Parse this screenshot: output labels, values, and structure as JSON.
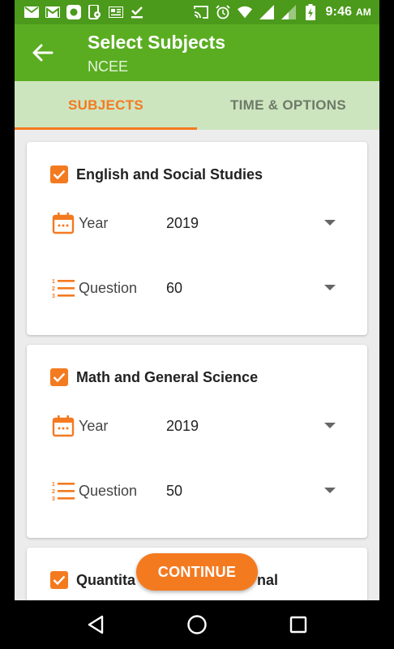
{
  "status_bar": {
    "time": "9:46",
    "ampm": "AM",
    "left_icons": [
      "mail-icon",
      "gmail-icon",
      "circle-app-icon",
      "phone-settings-icon",
      "news-icon",
      "download-done-icon"
    ],
    "right_icons": [
      "cast-icon",
      "alarm-icon",
      "wifi-icon",
      "signal-icon",
      "signal-weak-icon",
      "battery-charging-icon"
    ]
  },
  "app_bar": {
    "title": "Select Subjects",
    "subtitle": "NCEE",
    "back_icon": "arrow-back-icon"
  },
  "tabs": [
    {
      "label": "SUBJECTS",
      "active": true
    },
    {
      "label": "TIME & OPTIONS",
      "active": false
    }
  ],
  "subjects": [
    {
      "name": "English and Social Studies",
      "checked": true,
      "year_label": "Year",
      "year_value": "2019",
      "question_label": "Question",
      "question_value": "60"
    },
    {
      "name": "Math and General Science",
      "checked": true,
      "year_label": "Year",
      "year_value": "2019",
      "question_label": "Question",
      "question_value": "50"
    },
    {
      "name_left": "Quantita",
      "name_right": "nal",
      "checked": true
    }
  ],
  "continue_label": "CONTINUE",
  "colors": {
    "status_bar": "#4b9a1b",
    "app_bar": "#5aad21",
    "tab_bar": "#cde5bf",
    "accent": "#f47a20",
    "background": "#ececec"
  },
  "nav": [
    "back-triangle-icon",
    "home-circle-icon",
    "recents-square-icon"
  ]
}
